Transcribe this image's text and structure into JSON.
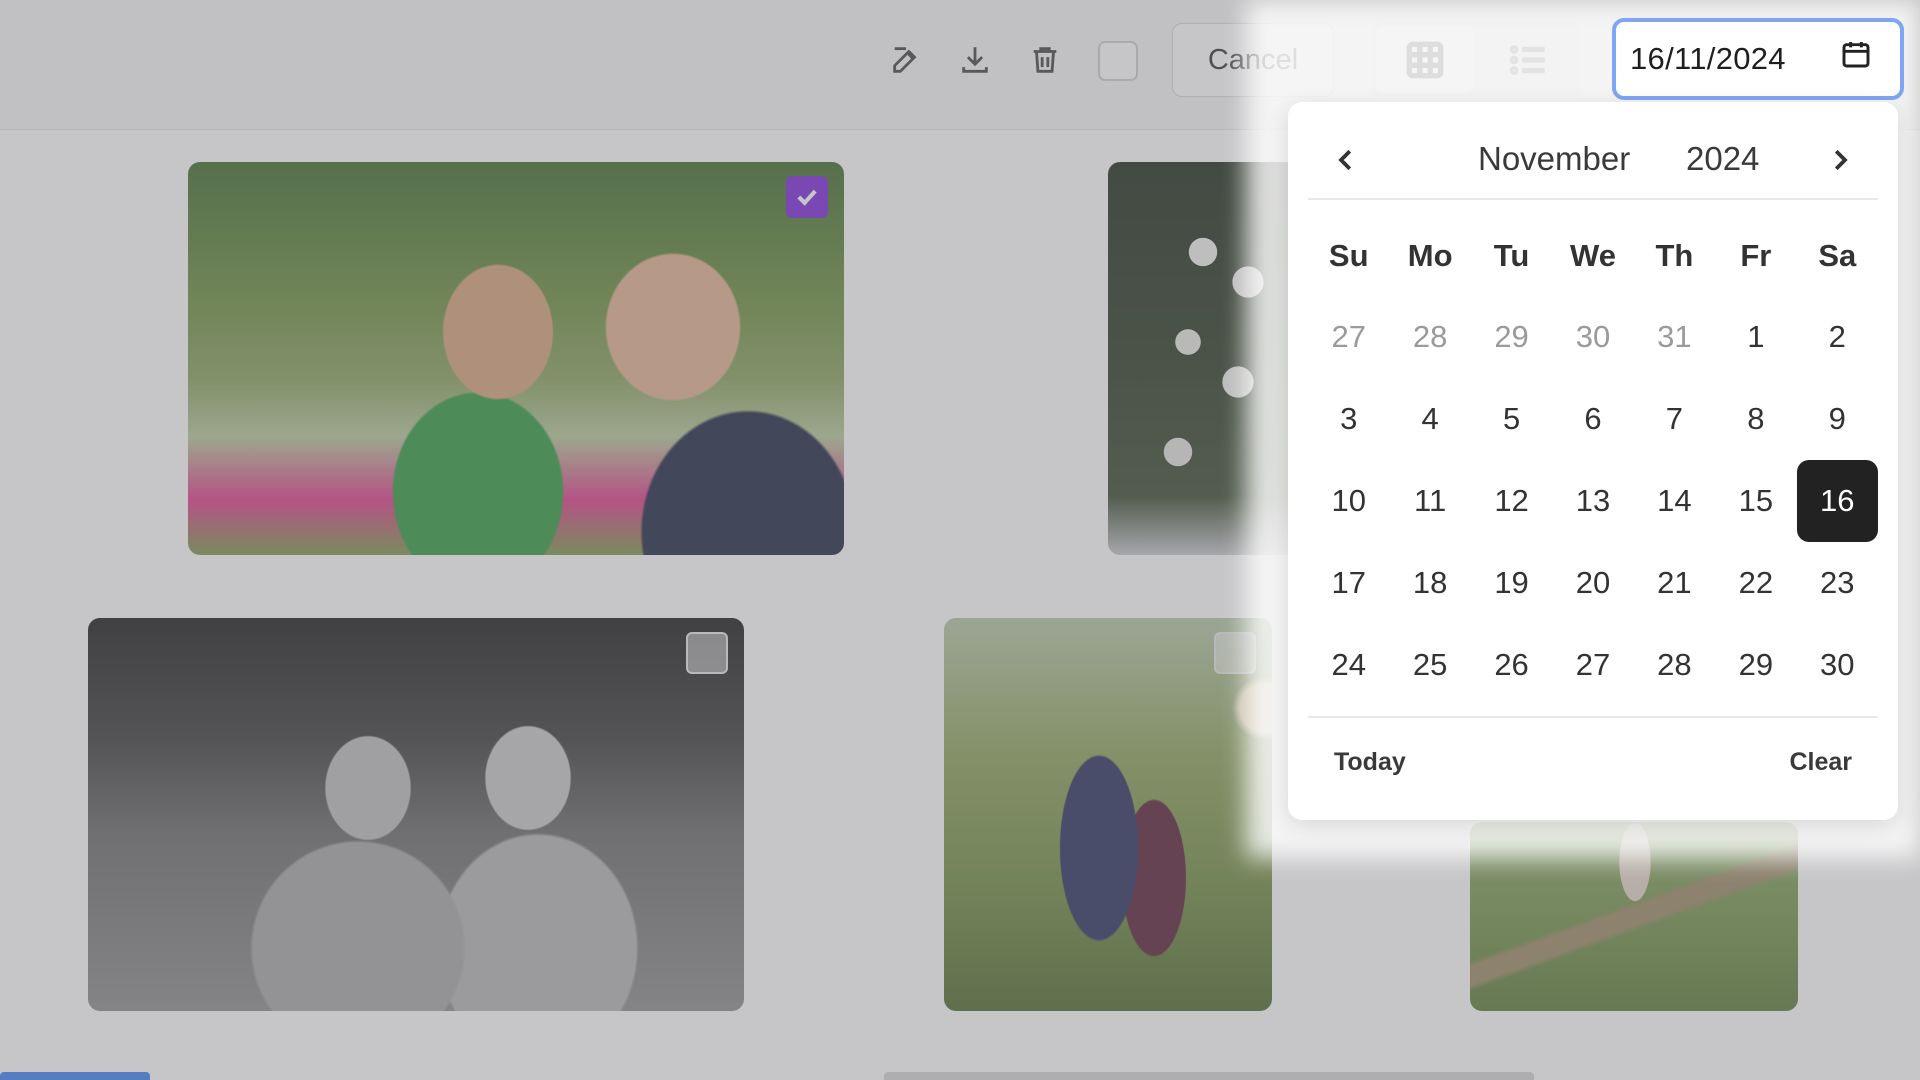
{
  "toolbar": {
    "cancel_label": "Cancel",
    "icons": [
      "edit-icon",
      "download-icon",
      "trash-icon"
    ]
  },
  "view_toggle": {
    "active": "grid",
    "options": [
      "grid-view-icon",
      "list-view-icon"
    ]
  },
  "date_input": {
    "value": "16/11/2024"
  },
  "calendar": {
    "month": "November",
    "year": "2024",
    "weekdays": [
      "Su",
      "Mo",
      "Tu",
      "We",
      "Th",
      "Fr",
      "Sa"
    ],
    "days": [
      {
        "label": "27",
        "muted": true
      },
      {
        "label": "28",
        "muted": true
      },
      {
        "label": "29",
        "muted": true
      },
      {
        "label": "30",
        "muted": true
      },
      {
        "label": "31",
        "muted": true
      },
      {
        "label": "1"
      },
      {
        "label": "2"
      },
      {
        "label": "3"
      },
      {
        "label": "4"
      },
      {
        "label": "5"
      },
      {
        "label": "6"
      },
      {
        "label": "7"
      },
      {
        "label": "8"
      },
      {
        "label": "9"
      },
      {
        "label": "10"
      },
      {
        "label": "11"
      },
      {
        "label": "12"
      },
      {
        "label": "13"
      },
      {
        "label": "14"
      },
      {
        "label": "15"
      },
      {
        "label": "16",
        "selected": true
      },
      {
        "label": "17"
      },
      {
        "label": "18"
      },
      {
        "label": "19"
      },
      {
        "label": "20"
      },
      {
        "label": "21"
      },
      {
        "label": "22"
      },
      {
        "label": "23"
      },
      {
        "label": "24"
      },
      {
        "label": "25"
      },
      {
        "label": "26"
      },
      {
        "label": "27"
      },
      {
        "label": "28"
      },
      {
        "label": "29"
      },
      {
        "label": "30"
      }
    ],
    "today_label": "Today",
    "clear_label": "Clear"
  },
  "photos": [
    {
      "name": "photo-boys-playing",
      "selected": true
    },
    {
      "name": "photo-white-flowers",
      "selected": false
    },
    {
      "name": "photo-girls-laughing",
      "selected": false
    },
    {
      "name": "photo-kids-reading",
      "selected": false
    },
    {
      "name": "photo-path-walking",
      "selected": false
    }
  ],
  "colors": {
    "accent_check": "#7a26d9",
    "focus_ring": "#7fa6f4",
    "selected_day": "#222222"
  }
}
